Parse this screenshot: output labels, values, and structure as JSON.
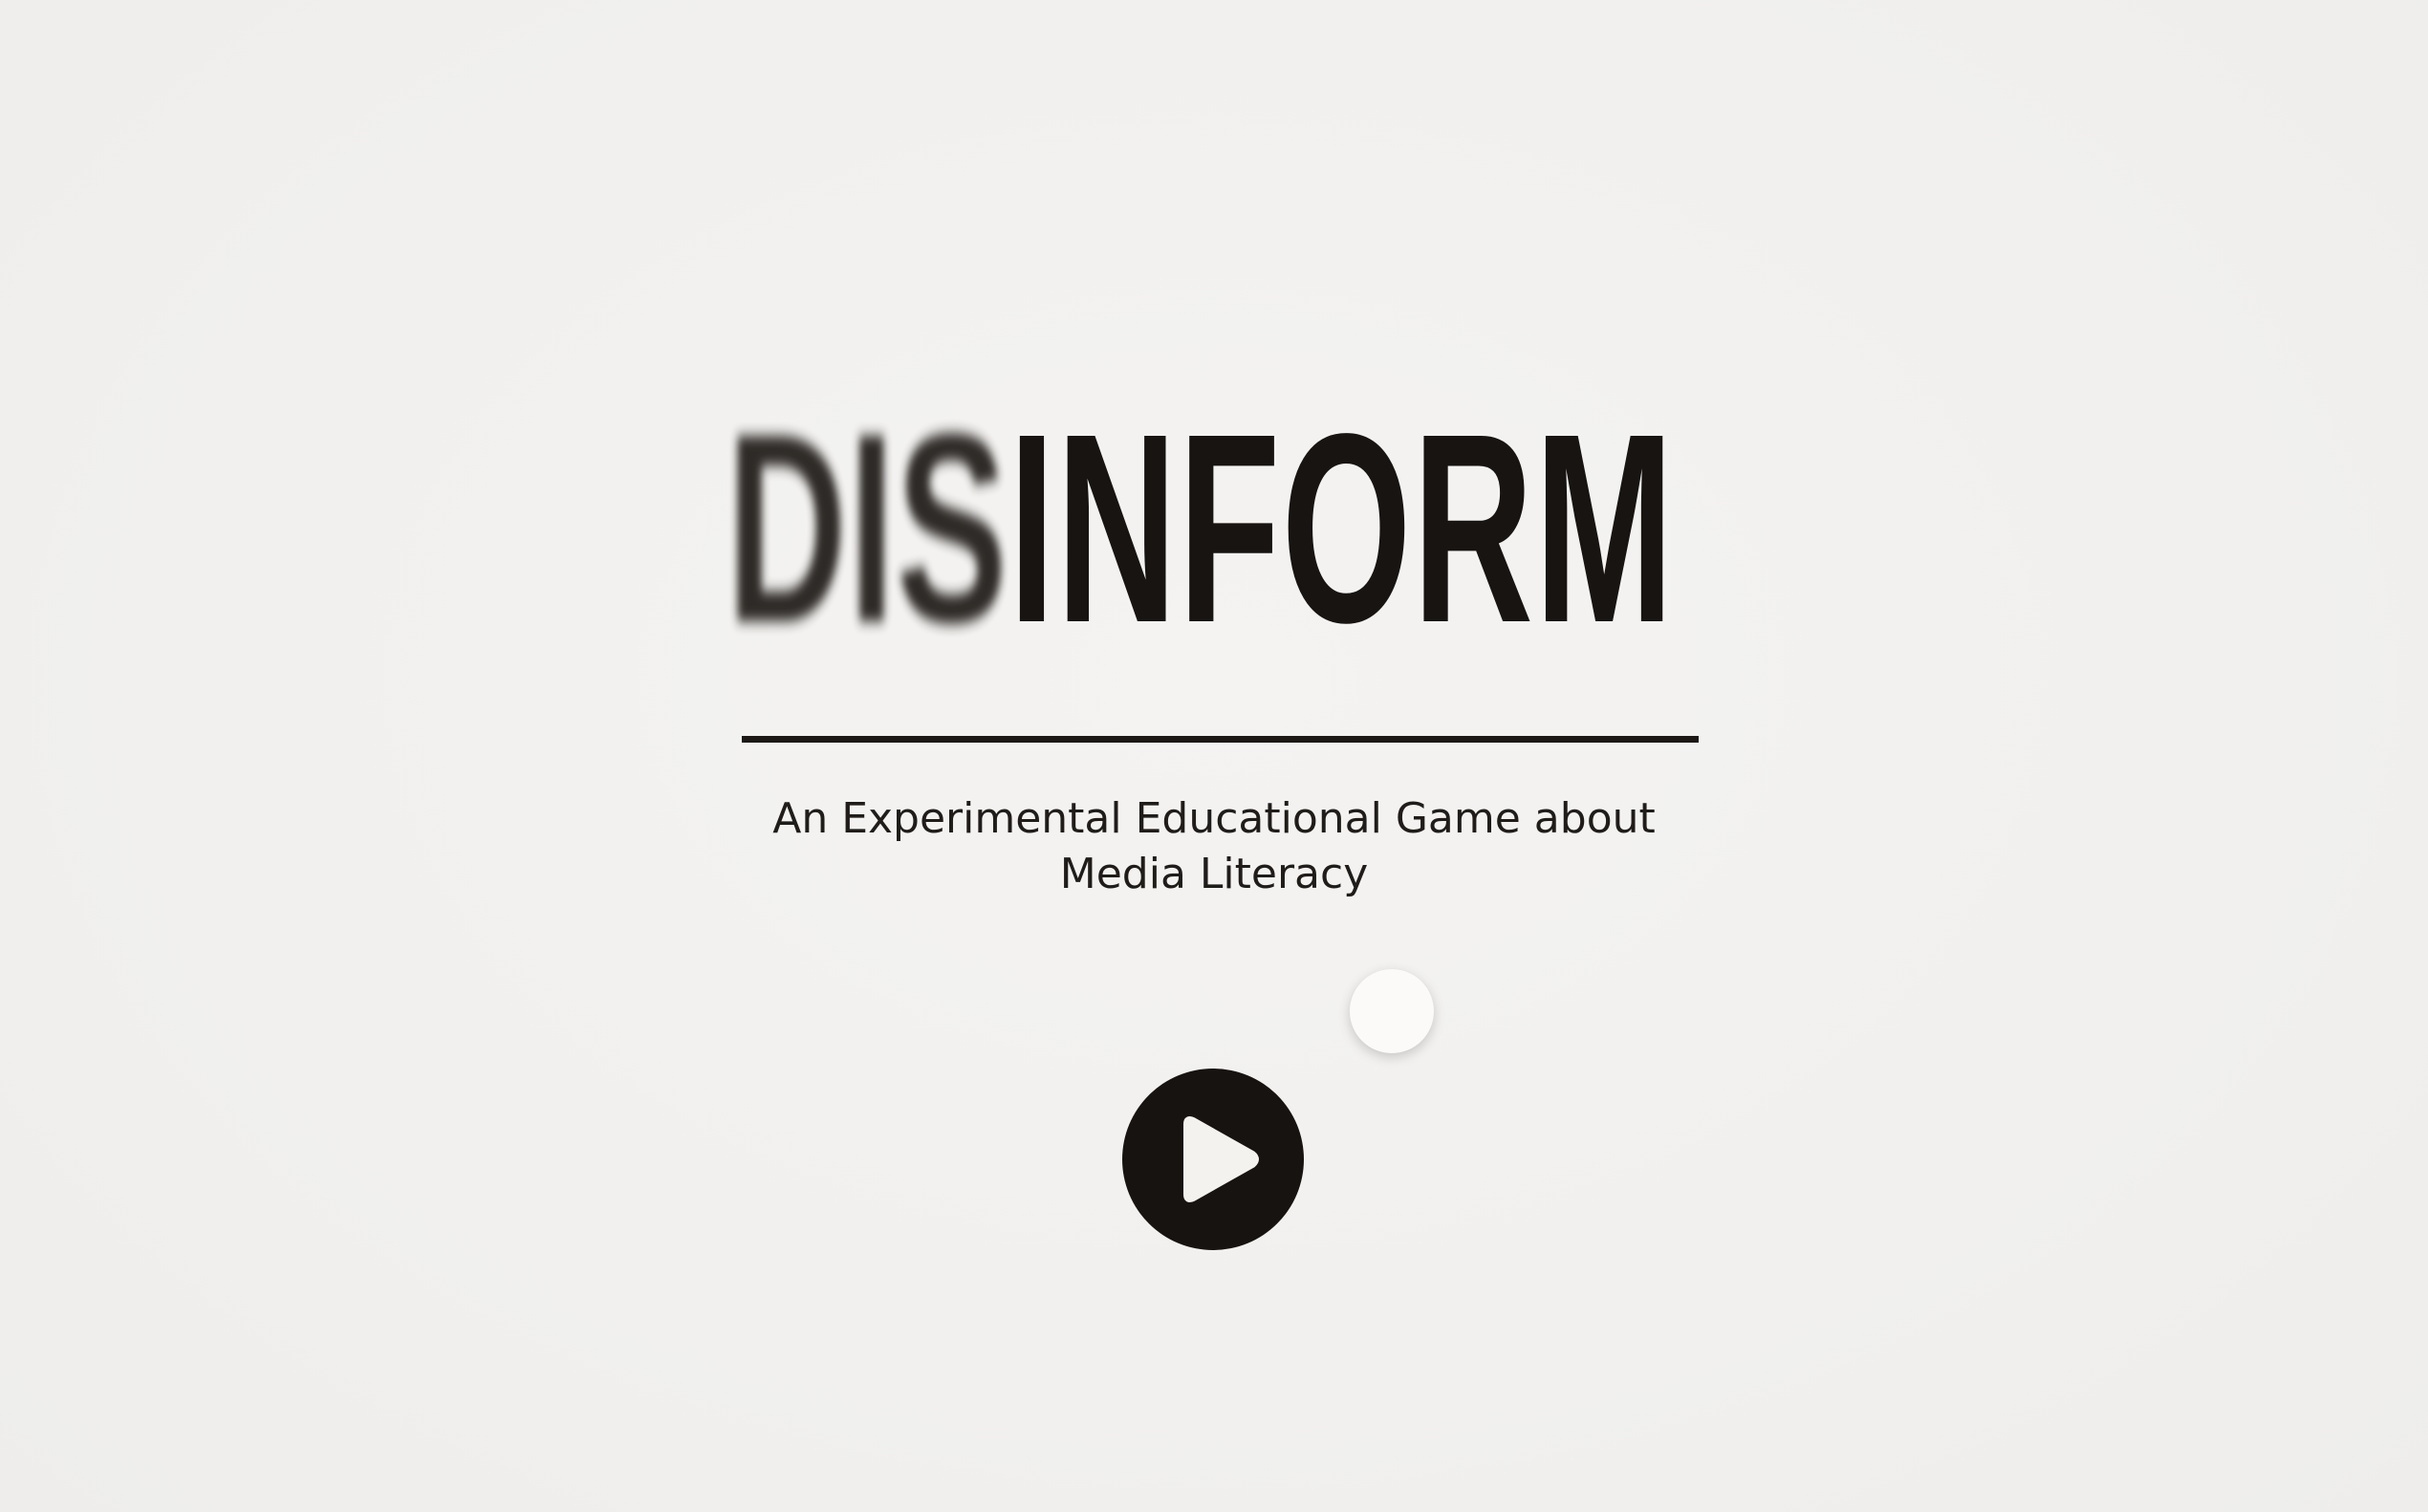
{
  "title": {
    "prefix": "DIS",
    "main": "INFORM"
  },
  "subtitle": {
    "line1": "An Experimental Educational Game about",
    "line2": "Media Literacy"
  },
  "play_button": {
    "icon": "play-icon"
  },
  "colors": {
    "background": "#f2f1ef",
    "ink": "#171412",
    "button": "#171310",
    "button_icon": "#f4f2ef"
  }
}
